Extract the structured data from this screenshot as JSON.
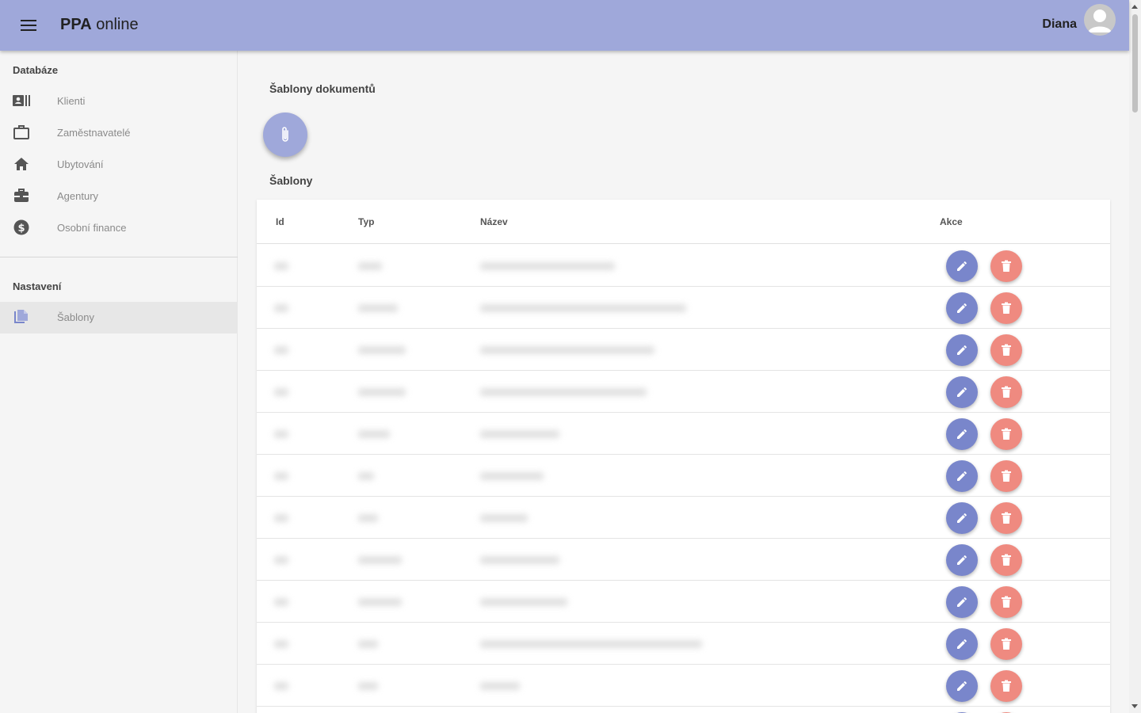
{
  "app": {
    "title_bold": "PPA",
    "title_light": "online",
    "user": "Diana"
  },
  "sidebar": {
    "database_label": "Databáze",
    "database_items": [
      {
        "label": "Klienti",
        "icon": "contact-card-icon"
      },
      {
        "label": "Zaměstnavatelé",
        "icon": "briefcase-outline-icon"
      },
      {
        "label": "Ubytování",
        "icon": "home-icon"
      },
      {
        "label": "Agentury",
        "icon": "toolbox-icon"
      },
      {
        "label": "Osobní finance",
        "icon": "dollar-circle-icon"
      }
    ],
    "settings_label": "Nastavení",
    "settings_items": [
      {
        "label": "Šablony",
        "icon": "document-copy-icon",
        "active": true
      }
    ]
  },
  "main": {
    "page_title": "Šablony dokumentů",
    "section_title": "Šablony",
    "table": {
      "headers": {
        "id": "Id",
        "type": "Typ",
        "name": "Název",
        "actions": "Akce"
      }
    }
  },
  "colors": {
    "primary": "#9fa8da",
    "edit": "#7986cb",
    "delete": "#ef8a80"
  }
}
